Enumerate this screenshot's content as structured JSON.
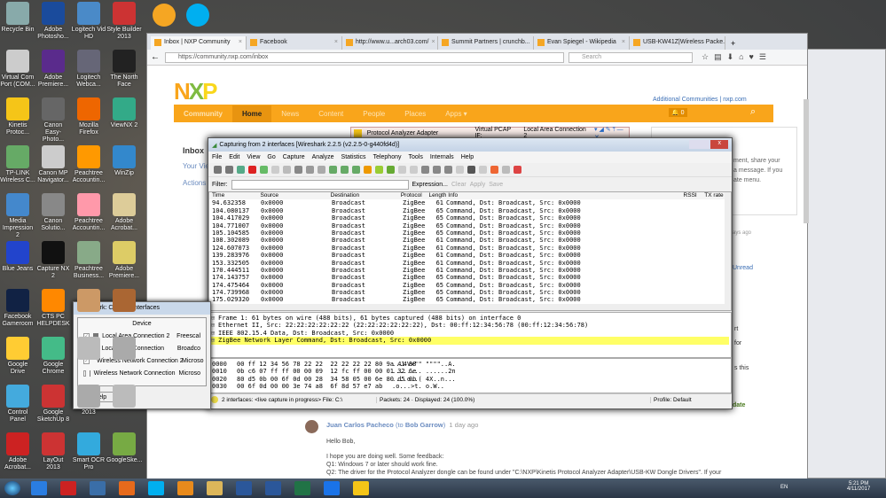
{
  "desktop_icons": [
    [
      "Recycle Bin",
      "Adobe Photosho...",
      "Logitech Vid HD",
      "Style Builder 2013"
    ],
    [
      "Virtual Com Port (COM...",
      "Adobe Premiere...",
      "Logitech Webca...",
      "The North Face"
    ],
    [
      "Kinetis Protoc...",
      "Canon Easy-Photo...",
      "Mozilla Firefox",
      "ViewNX 2"
    ],
    [
      "TP-LINK Wireless C...",
      "Canon MP Navigator...",
      "Peachtree Accountin...",
      "WinZip"
    ],
    [
      "Media Impression 2",
      "Canon Solutio...",
      "Peachtree Accountin...",
      "Adobe Acrobat..."
    ],
    [
      "Blue Jeans",
      "Capture NX 2",
      "Peachtree Business...",
      "Adobe Premiere..."
    ],
    [
      "Facebook Gameroom",
      "CTS PC HELPDESK",
      "",
      ""
    ],
    [
      "Google Drive",
      "Google Chrome",
      "",
      ""
    ],
    [
      "Control Panel",
      "Google SketchUp 8",
      "2013",
      ""
    ],
    [
      "Adobe Acrobat...",
      "LayOut 2013",
      "Smart OCR Pro",
      "GoogleSke..."
    ]
  ],
  "browser": {
    "tabs": [
      "Inbox | NXP Community",
      "Facebook",
      "http://www.u...arch03.com/",
      "Summit Partners | crunchb...",
      "Evan Spiegel - Wikipedia",
      "USB-KW41Z|Wireless Packe..."
    ],
    "url": "https://community.nxp.com/inbox",
    "search_placeholder": "Search",
    "logo": "NXP",
    "additional": "Additional Communities",
    "nxp_link": "nxp.com",
    "nav": [
      "Community",
      "Home",
      "News",
      "Content",
      "People",
      "Places",
      "Apps ▾"
    ],
    "notif_count": "0",
    "left": {
      "inbox": "Inbox",
      "your_view": "Your View",
      "actions": "Actions"
    },
    "right_panel": [
      "ment, share your",
      "a message. If you",
      "ate menu."
    ],
    "right_snips": [
      "ays ago",
      "Unread",
      "rt",
      "for",
      "s this",
      "date"
    ],
    "comment": {
      "author": "Juan Carlos Pacheco",
      "to_prefix": "(to",
      "to": "Bob Garrow",
      "to_suffix": ")",
      "time": "1 day ago",
      "lines": [
        "Hello Bob,",
        "I hope you are doing well. Some feedback:",
        "Q1: Windows 7 or later should work fine.",
        "Q2: The driver for the Protocol Analyzer dongle can be found under \"C:\\NXP\\Kinetis Protocol Analyzer Adapter\\USB-KW Dongle Drivers\". If your"
      ]
    }
  },
  "adapter_bar": {
    "title": "Protocol Analyzer Adapter",
    "label": "Virtual PCAP IF:",
    "value": "Local Area Connection 2"
  },
  "wireshark": {
    "title": "Capturing from 2 interfaces [Wireshark 2.2.5 (v2.2.5-0-g440fd4d)]",
    "menu": [
      "File",
      "Edit",
      "View",
      "Go",
      "Capture",
      "Analyze",
      "Statistics",
      "Telephony",
      "Tools",
      "Internals",
      "Help"
    ],
    "filter_label": "Filter:",
    "filter_buttons": [
      "Expression...",
      "Clear",
      "Apply",
      "Save"
    ],
    "columns": [
      "Time",
      "Source",
      "Destination",
      "Protocol",
      "Length",
      "Info",
      "RSSI",
      "TX rate"
    ],
    "packets": [
      [
        "94.632358",
        "0x0000",
        "Broadcast",
        "ZigBee",
        "61",
        "Command, Dst: Broadcast, Src: 0x0000"
      ],
      [
        "104.080137",
        "0x0000",
        "Broadcast",
        "ZigBee",
        "65",
        "Command, Dst: Broadcast, Src: 0x0000"
      ],
      [
        "104.417029",
        "0x0000",
        "Broadcast",
        "ZigBee",
        "65",
        "Command, Dst: Broadcast, Src: 0x0000"
      ],
      [
        "104.771007",
        "0x0000",
        "Broadcast",
        "ZigBee",
        "65",
        "Command, Dst: Broadcast, Src: 0x0000"
      ],
      [
        "105.104585",
        "0x0000",
        "Broadcast",
        "ZigBee",
        "65",
        "Command, Dst: Broadcast, Src: 0x0000"
      ],
      [
        "108.302089",
        "0x0000",
        "Broadcast",
        "ZigBee",
        "61",
        "Command, Dst: Broadcast, Src: 0x0000"
      ],
      [
        "124.607073",
        "0x0000",
        "Broadcast",
        "ZigBee",
        "61",
        "Command, Dst: Broadcast, Src: 0x0000"
      ],
      [
        "139.283976",
        "0x0000",
        "Broadcast",
        "ZigBee",
        "61",
        "Command, Dst: Broadcast, Src: 0x0000"
      ],
      [
        "153.332505",
        "0x0000",
        "Broadcast",
        "ZigBee",
        "61",
        "Command, Dst: Broadcast, Src: 0x0000"
      ],
      [
        "170.444511",
        "0x0000",
        "Broadcast",
        "ZigBee",
        "61",
        "Command, Dst: Broadcast, Src: 0x0000"
      ],
      [
        "174.143757",
        "0x0000",
        "Broadcast",
        "ZigBee",
        "65",
        "Command, Dst: Broadcast, Src: 0x0000"
      ],
      [
        "174.475464",
        "0x0000",
        "Broadcast",
        "ZigBee",
        "65",
        "Command, Dst: Broadcast, Src: 0x0000"
      ],
      [
        "174.739968",
        "0x0000",
        "Broadcast",
        "ZigBee",
        "65",
        "Command, Dst: Broadcast, Src: 0x0000"
      ],
      [
        "175.029320",
        "0x0000",
        "Broadcast",
        "ZigBee",
        "65",
        "Command, Dst: Broadcast, Src: 0x0000"
      ]
    ],
    "details": [
      "Frame 1: 61 bytes on wire (488 bits), 61 bytes captured (488 bits) on interface 0",
      "Ethernet II, Src: 22:22:22:22:22:22 (22:22:22:22:22:22), Dst: 00:ff:12:34:56:78 (00:ff:12:34:56:78)",
      "IEEE 802.15.4 Data, Dst: Broadcast, Src: 0x0000",
      "ZigBee Network Layer Command, Dst: Broadcast, Src: 0x0000"
    ],
    "hex": [
      [
        "0000",
        "00 ff 12 34 56 78 22 22  22 22 22 22 80 9a 41 88",
        "...4Vx\"\" \"\"\"\"..A."
      ],
      [
        "0010",
        "0b c6 07 ff ff 00 00 09  12 fc ff 00 00 01 32 6e",
        "........ ......2n"
      ],
      [
        "0020",
        "80 d5 0b 00 6f 0d 00 28  34 58 05 00 6e 80 d5 0b",
        "....o..( 4X..n..."
      ],
      [
        "0030",
        "00 6f 0d 00 00 3e 74 a8  6f 8d 57 e7 ab",
        ".o...>t. o.W.."
      ]
    ],
    "status": {
      "interfaces": "2 interfaces: <live capture in progress> File: C:\\",
      "packets": "Packets: 24 · Displayed: 24 (100.0%)",
      "profile": "Profile: Default"
    }
  },
  "capture_dialog": {
    "title": "Wireshark: Capture Interfaces",
    "header": "Device",
    "devices": [
      {
        "name": "Local Area Connection 2",
        "desc": "Freescal",
        "checked": true
      },
      {
        "name": "Local Area Connection",
        "desc": "Broadco",
        "checked": false
      },
      {
        "name": "Wireless Network Connection 2",
        "desc": "Microso",
        "checked": true
      },
      {
        "name": "Wireless Network Connection",
        "desc": "Microso",
        "checked": false
      }
    ],
    "help": "Help"
  },
  "taskbar": {
    "lang": "EN",
    "time": "5:21 PM",
    "date": "4/11/2017"
  }
}
